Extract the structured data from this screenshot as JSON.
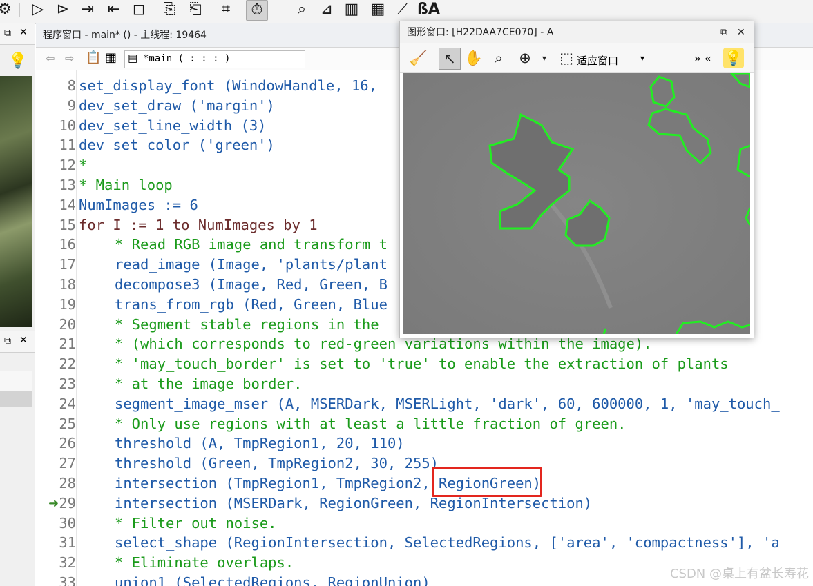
{
  "colors": {
    "operator": "#1f5aa8",
    "comment": "#1a9a1a",
    "control": "#6b2c2c",
    "region_outline": "#22ee22",
    "highlight_box": "#e3261e"
  },
  "toolbar": {
    "icons": [
      "run-icon",
      "step-over-icon",
      "step-into-icon",
      "step-out-icon",
      "stop-icon",
      "reset-program-icon",
      "reset-procedure-icon",
      "profiler-icon",
      "timer-icon",
      "zoom-icon",
      "line-profile-icon",
      "histogram-icon",
      "feature-histogram-icon",
      "feature-inspection-icon",
      "font-icon"
    ]
  },
  "program_window": {
    "title": "程序窗口 - main* () - 主线程: 19464",
    "procedure": "*main ( : : : )",
    "current_line": 29,
    "highlight": "RegionGreen"
  },
  "code": [
    {
      "n": "8",
      "text": "set_display_font (WindowHandle, 16,",
      "cls": "op",
      "indent": 0
    },
    {
      "n": "9",
      "text": "dev_set_draw ('margin')",
      "cls": "op",
      "indent": 0
    },
    {
      "n": "10",
      "text": "dev_set_line_width (3)",
      "cls": "op",
      "indent": 0
    },
    {
      "n": "11",
      "text": "dev_set_color ('green')",
      "cls": "op",
      "indent": 0
    },
    {
      "n": "12",
      "text": "*",
      "cls": "cm",
      "indent": 0
    },
    {
      "n": "13",
      "text": "* Main loop",
      "cls": "cm",
      "indent": 0
    },
    {
      "n": "14",
      "text": "NumImages := 6",
      "cls": "op",
      "indent": 0
    },
    {
      "n": "15",
      "text": "for I := 1 to NumImages by 1",
      "cls": "cf",
      "indent": 0
    },
    {
      "n": "16",
      "text": "* Read RGB image and transform t",
      "cls": "cm",
      "indent": 1
    },
    {
      "n": "17",
      "text": "read_image (Image, 'plants/plant",
      "cls": "op",
      "indent": 1
    },
    {
      "n": "18",
      "text": "decompose3 (Image, Red, Green, B",
      "cls": "op",
      "indent": 1
    },
    {
      "n": "19",
      "text": "trans_from_rgb (Red, Green, Blue",
      "cls": "op",
      "indent": 1
    },
    {
      "n": "20",
      "text": "* Segment stable regions in the",
      "cls": "cm",
      "indent": 1
    },
    {
      "n": "21",
      "text": "* (which corresponds to red-green variations within the image).",
      "cls": "cm",
      "indent": 1
    },
    {
      "n": "22",
      "text": "* 'may_touch_border' is set to 'true' to enable the extraction of plants",
      "cls": "cm",
      "indent": 1
    },
    {
      "n": "23",
      "text": "* at the image border.",
      "cls": "cm",
      "indent": 1
    },
    {
      "n": "24",
      "text": "segment_image_mser (A, MSERDark, MSERLight, 'dark', 60, 600000, 1, 'may_touch_",
      "cls": "op",
      "indent": 1
    },
    {
      "n": "25",
      "text": "* Only use regions with at least a little fraction of green.",
      "cls": "cm",
      "indent": 1
    },
    {
      "n": "26",
      "text": "threshold (A, TmpRegion1, 20, 110)",
      "cls": "op",
      "indent": 1
    },
    {
      "n": "27",
      "text": "threshold (Green, TmpRegion2, 30, 255)",
      "cls": "op",
      "indent": 1
    },
    {
      "n": "28",
      "text": "intersection (TmpRegion1, TmpRegion2, RegionGreen)",
      "cls": "op",
      "indent": 1
    },
    {
      "n": "29",
      "text": "intersection (MSERDark, RegionGreen, RegionIntersection)",
      "cls": "op",
      "indent": 1
    },
    {
      "n": "30",
      "text": "* Filter out noise.",
      "cls": "cm",
      "indent": 1
    },
    {
      "n": "31",
      "text": "select_shape (RegionIntersection, SelectedRegions, ['area', 'compactness'], 'a",
      "cls": "op",
      "indent": 1
    },
    {
      "n": "32",
      "text": "* Eliminate overlaps.",
      "cls": "cm",
      "indent": 1
    },
    {
      "n": "33",
      "text": "union1 (SelectedRegions, RegionUnion)",
      "cls": "op",
      "indent": 1
    }
  ],
  "graphics_window": {
    "title": "图形窗口: [H22DAA7CE070] - A",
    "fit_label": "适应窗口",
    "icons": [
      "clear-icon",
      "pointer-icon",
      "hand-icon",
      "magnify-icon",
      "zoom-in-icon",
      "fit-window-icon",
      "lightbulb-icon"
    ]
  },
  "watermark": "CSDN @桌上有盆长寿花"
}
